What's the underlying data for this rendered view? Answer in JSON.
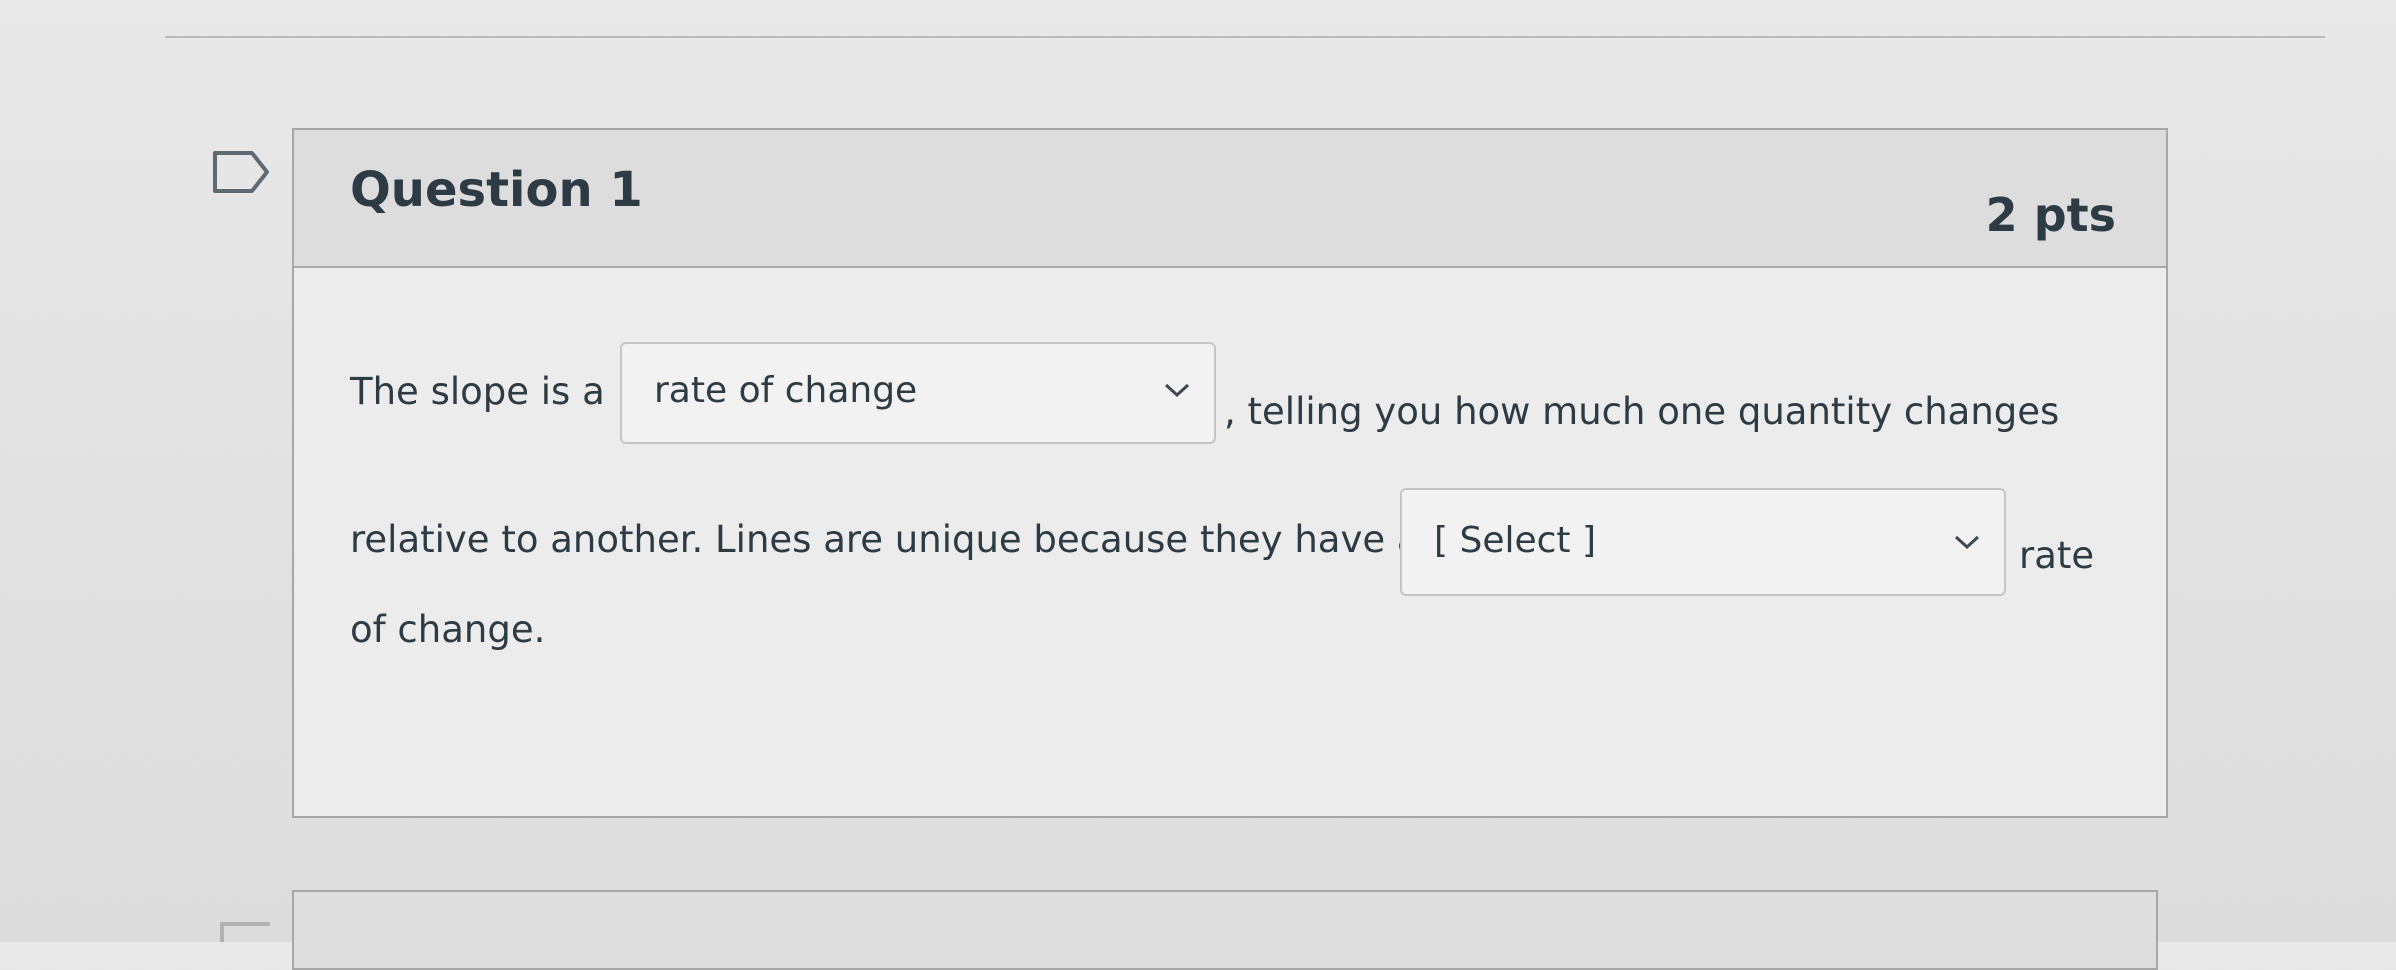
{
  "question": {
    "title": "Question 1",
    "points": "2 pts"
  },
  "sentence": {
    "part1": "The slope is a",
    "part2": ", telling you how much one quantity changes",
    "part3": "relative to another. Lines are unique because they have a",
    "part4": "rate",
    "part5": "of change."
  },
  "dropdown1": {
    "selected": "rate of change"
  },
  "dropdown2": {
    "selected": "[ Select ]"
  },
  "icons": {
    "flag": "flag-icon",
    "chevron": "chevron-down-icon"
  },
  "colors": {
    "text": "#2d3b45",
    "header_bg": "#dddddd",
    "border": "#a7a7a7"
  }
}
